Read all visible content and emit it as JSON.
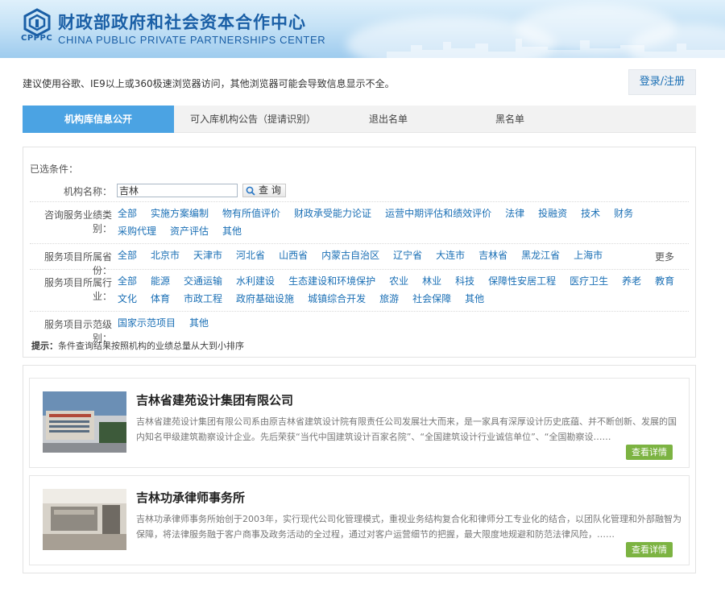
{
  "header": {
    "logo_text": "CPPPC",
    "title_cn": "财政部政府和社会资本合作中心",
    "title_en": "CHINA PUBLIC PRIVATE PARTNERSHIPS CENTER"
  },
  "notice": "建议使用谷歌、IE9以上或360极速浏览器访问，其他浏览器可能会导致信息显示不全。",
  "login_label": "登录/注册",
  "tabs": [
    {
      "label": "机构库信息公开",
      "active": true
    },
    {
      "label": "可入库机构公告（提请识别）",
      "active": false
    },
    {
      "label": "退出名单",
      "active": false
    },
    {
      "label": "黑名单",
      "active": false
    }
  ],
  "filter": {
    "selected_label": "已选条件：",
    "name_label": "机构名称：",
    "name_value": "吉林",
    "search_label": "查 询",
    "business_label": "咨询服务业绩类别：",
    "business_options": [
      "全部",
      "实施方案编制",
      "物有所值评价",
      "财政承受能力论证",
      "运营中期评估和绩效评价",
      "法律",
      "投融资",
      "技术",
      "财务",
      "采购代理",
      "资产评估",
      "其他"
    ],
    "province_label": "服务项目所属省份：",
    "province_options": [
      "全部",
      "北京市",
      "天津市",
      "河北省",
      "山西省",
      "内蒙古自治区",
      "辽宁省",
      "大连市",
      "吉林省",
      "黑龙江省",
      "上海市"
    ],
    "more_label": "更多",
    "industry_label": "服务项目所属行业：",
    "industry_options": [
      "全部",
      "能源",
      "交通运输",
      "水利建设",
      "生态建设和环境保护",
      "农业",
      "林业",
      "科技",
      "保障性安居工程",
      "医疗卫生",
      "养老",
      "教育",
      "文化",
      "体育",
      "市政工程",
      "政府基础设施",
      "城镇综合开发",
      "旅游",
      "社会保障",
      "其他"
    ],
    "demo_label": "服务项目示范级别：",
    "demo_options": [
      "国家示范项目",
      "其他"
    ],
    "hint_prefix": "提示：",
    "hint_text": "条件查询结果按照机构的业绩总量从大到小排序"
  },
  "results": [
    {
      "name": "吉林省建苑设计集团有限公司",
      "desc": "吉林省建苑设计集团有限公司系由原吉林省建筑设计院有限责任公司发展壮大而来，是一家具有深厚设计历史底蕴、并不断创新、发展的国内知名甲级建筑勘察设计企业。先后荣获“当代中国建筑设计百家名院”、“全国建筑设计行业诚信单位”、“全国勘察设……",
      "detail_label": "查看详情"
    },
    {
      "name": "吉林功承律师事务所",
      "desc": "吉林功承律师事务所始创于2003年，实行现代公司化管理模式，重视业务结构复合化和律师分工专业化的结合，以团队化管理和外部融智为保障，将法律服务融于客户商事及政务活动的全过程，通过对客户运营细节的把握，最大限度地规避和防范法律风险，……",
      "detail_label": "查看详情"
    }
  ]
}
